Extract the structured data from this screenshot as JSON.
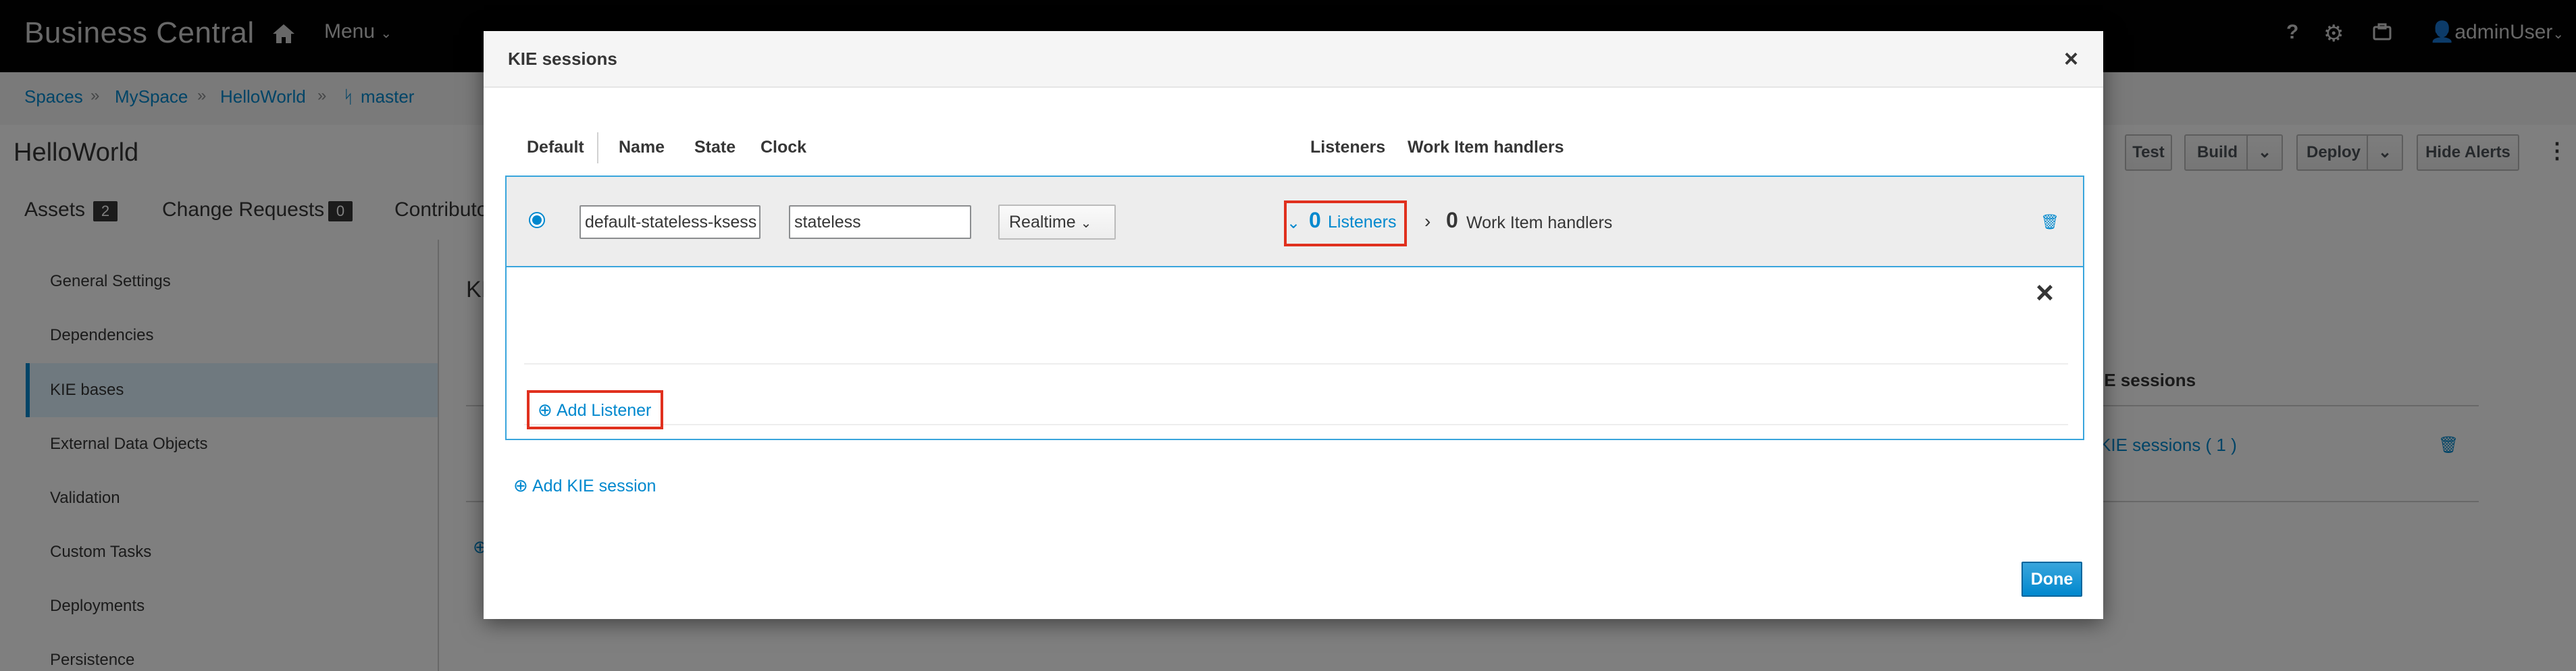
{
  "navbar": {
    "brand": "Business Central",
    "menu_label": "Menu",
    "help": "?",
    "user": "adminUser"
  },
  "breadcrumbs": {
    "items": [
      "Spaces",
      "MySpace",
      "HelloWorld",
      "master"
    ]
  },
  "project": {
    "title": "HelloWorld",
    "toolbar": {
      "test": "Test",
      "build": "Build",
      "deploy": "Deploy",
      "hide_alerts": "Hide Alerts"
    },
    "tabs": [
      {
        "label": "Assets",
        "count": "2"
      },
      {
        "label": "Change Requests",
        "count": "0"
      },
      {
        "label": "Contributo"
      }
    ]
  },
  "sidebar": {
    "items": [
      "General Settings",
      "Dependencies",
      "KIE bases",
      "External Data Objects",
      "Validation",
      "Custom Tasks",
      "Deployments",
      "Persistence"
    ],
    "active_index": 2
  },
  "background": {
    "heading_fragment": "KI",
    "column_sessions": "IE sessions",
    "link_sessions": "KIE sessions ( 1 )"
  },
  "modal": {
    "title": "KIE sessions",
    "columns": {
      "default": "Default",
      "name": "Name",
      "state": "State",
      "clock": "Clock",
      "listeners": "Listeners",
      "work_item_handlers": "Work Item handlers"
    },
    "session": {
      "name": "default-stateless-ksess",
      "state": "stateless",
      "clock": "Realtime",
      "listeners_count": "0",
      "listeners_label": "Listeners",
      "wih_count": "0",
      "wih_label": "Work Item handlers"
    },
    "add_listener": "Add Listener",
    "add_session": "Add KIE session",
    "done": "Done"
  },
  "colors": {
    "accent": "#0088ce",
    "highlight": "#e0301e",
    "navbar": "#030303"
  }
}
